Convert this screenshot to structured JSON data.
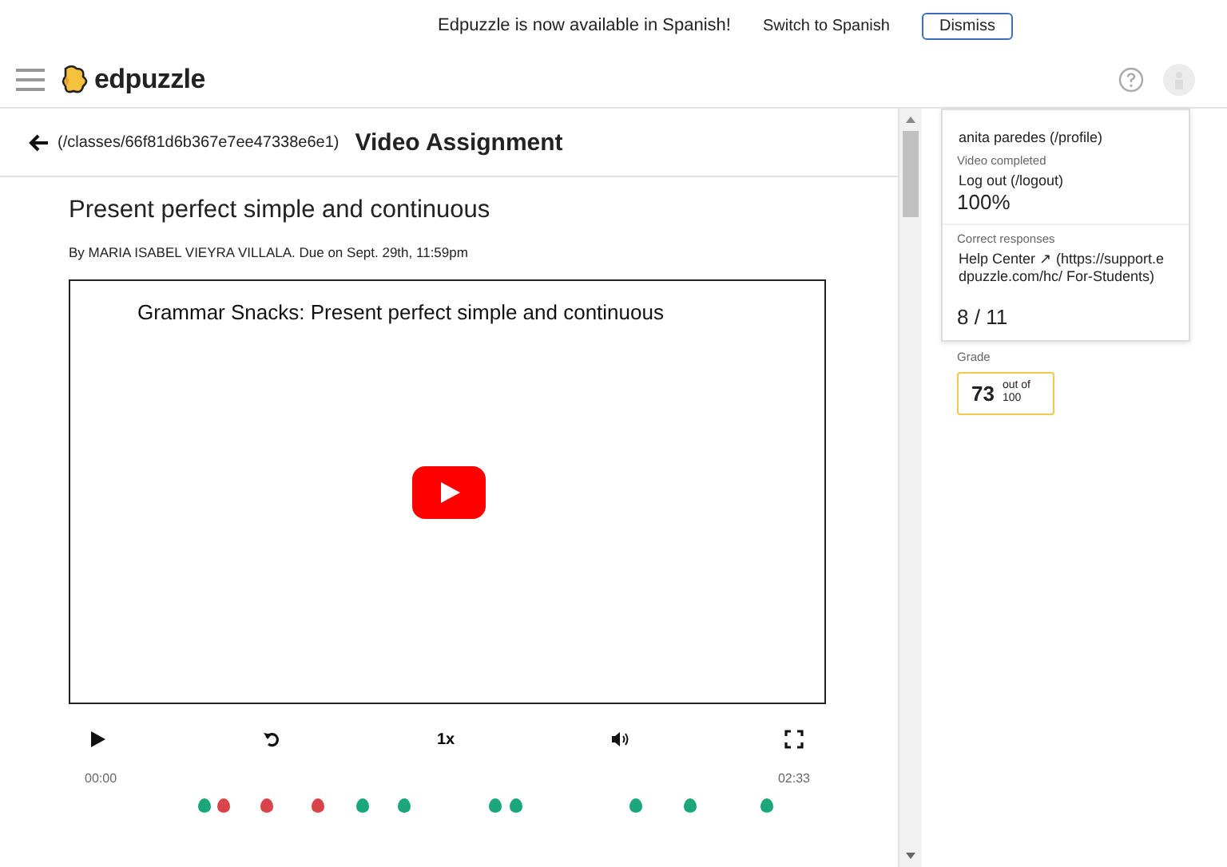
{
  "banner": {
    "message": "Edpuzzle is now available in Spanish!",
    "switch_link": "Switch to Spanish",
    "dismiss_button": "Dismiss"
  },
  "header": {
    "logo_text": "edpuzzle"
  },
  "assignment": {
    "back_link": "(/classes/66f81d6b367e7ee47338e6e1)",
    "page_title": "Video Assignment",
    "title": "Present perfect simple and continuous",
    "byline": "By MARIA ISABEL VIEYRA VILLALA. Due on Sept. 29th, 11:59pm"
  },
  "video": {
    "title": "Grammar Snacks: Present perfect simple and continuous",
    "speed": "1x",
    "elapsed": "00:00",
    "duration": "02:33",
    "questions": [
      {
        "color": "#1ba67b"
      },
      {
        "color": "#d9434a"
      },
      {
        "color": "#d9434a"
      },
      {
        "color": "#d9434a"
      },
      {
        "color": "#1ba67b"
      },
      {
        "color": "#1ba67b"
      },
      {
        "color": "#1ba67b"
      },
      {
        "color": "#1ba67b"
      },
      {
        "color": "#1ba67b"
      },
      {
        "color": "#1ba67b"
      },
      {
        "color": "#1ba67b"
      }
    ]
  },
  "stats": {
    "completed_label": "Video completed",
    "completed_value": "100%",
    "correct_label": "Correct responses",
    "correct_value": "8 / 11",
    "grade_label": "Grade",
    "grade_value": "73",
    "grade_max": "out of 100"
  },
  "user_menu": {
    "items": [
      "anita paredes (/profile)",
      "Log out (/logout)",
      "Help Center ↗ (https://support.edpuzzle.com/hc/ For-Students)"
    ]
  }
}
